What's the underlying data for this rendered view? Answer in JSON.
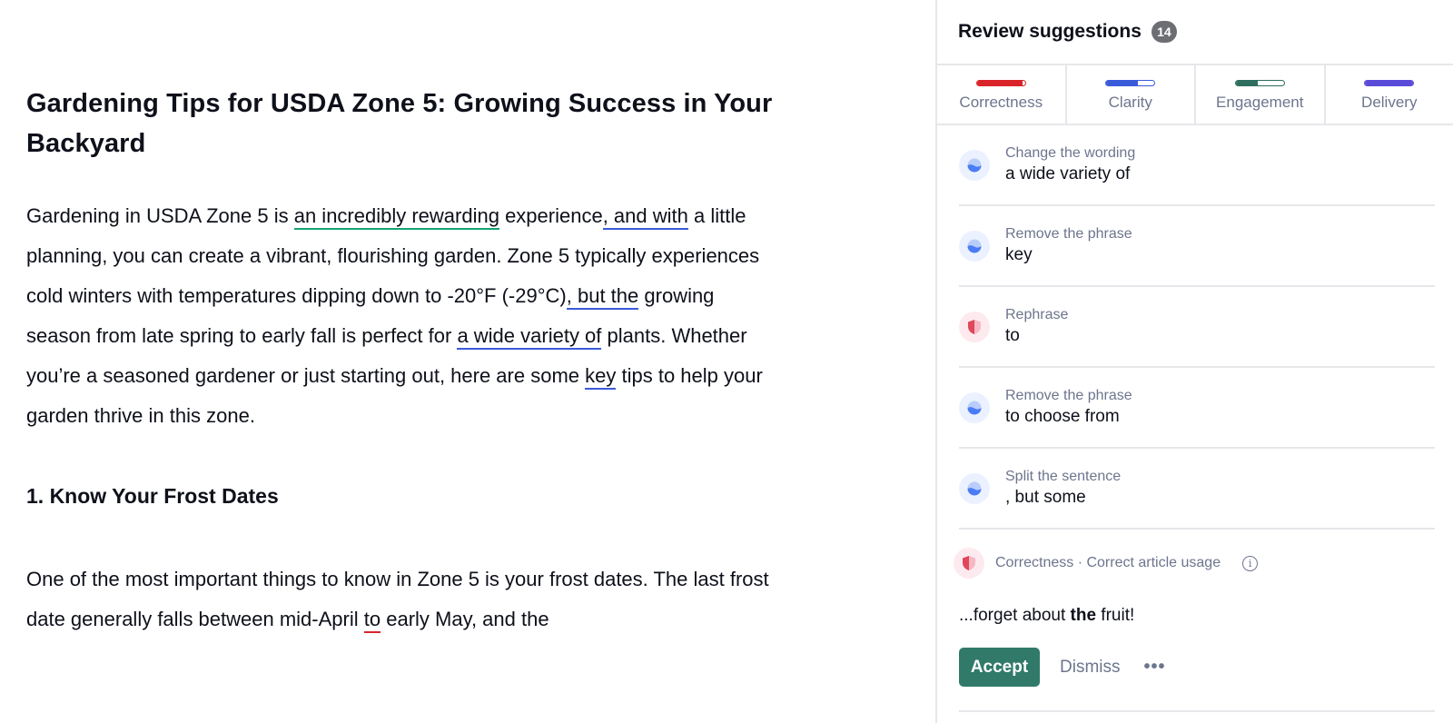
{
  "document": {
    "title": "Gardening Tips for USDA Zone 5: Growing Success in Your Backyard",
    "intro": {
      "t1": "Gardening in USDA Zone 5 is ",
      "h1": "an incredibly rewarding",
      "t2": " experience",
      "h2": ", and with",
      "t3": " a little planning, you can create a vibrant, flourishing garden. Zone 5 typically experiences cold winters with temperatures dipping down to -20°F (-29°C)",
      "h3": ", but the",
      "t4": " growing season from late spring to early fall is perfect for ",
      "h4": "a wide variety of",
      "t5": " plants. Whether you’re a seasoned gardener or just starting out, here are some ",
      "h5": "key",
      "t6": " tips to help your garden thrive in this zone."
    },
    "section1_heading": "1. Know Your Frost Dates",
    "section1": {
      "t1": "One of the most important things to know in Zone 5 is your frost dates. The last frost date generally falls between mid-April ",
      "h1": "to",
      "t2": " early May, and the"
    }
  },
  "sidebar": {
    "title": "Review suggestions",
    "count": "14",
    "tabs": [
      {
        "label": "Correctness",
        "progress": 0.95,
        "color": "#d9252a"
      },
      {
        "label": "Clarity",
        "progress": 0.65,
        "color": "#3a5bd9"
      },
      {
        "label": "Engagement",
        "progress": 0.45,
        "color": "#2d6e5e"
      },
      {
        "label": "Delivery",
        "progress": 1.0,
        "color": "#5b4bd9"
      }
    ],
    "suggestions": [
      {
        "kind": "Change the wording",
        "value": "a wide variety of",
        "category": "clarity"
      },
      {
        "kind": "Remove the phrase",
        "value": "key",
        "category": "clarity"
      },
      {
        "kind": "Rephrase",
        "value": "to",
        "category": "correctness"
      },
      {
        "kind": "Remove the phrase",
        "value": "to choose from",
        "category": "clarity"
      },
      {
        "kind": "Split the sentence",
        "value": ", but some",
        "category": "clarity"
      }
    ],
    "expanded": {
      "meta": "Correctness · Correct article usage",
      "text_before": "...forget about ",
      "text_bold": "the",
      "text_after": " fruit!",
      "accept_label": "Accept",
      "dismiss_label": "Dismiss",
      "more_label": "•••"
    }
  }
}
